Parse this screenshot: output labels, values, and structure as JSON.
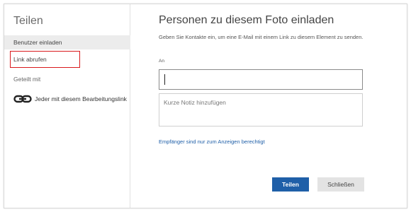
{
  "sidebar": {
    "title": "Teilen",
    "items": [
      {
        "label": "Benutzer einladen",
        "selected": true
      },
      {
        "label": "Link abrufen",
        "selected": false,
        "highlighted": true
      }
    ],
    "shared_with_label": "Geteilt mit",
    "shared_entries": [
      {
        "icon": "link-icon",
        "label": "Jeder mit diesem Bearbeitungslink"
      }
    ]
  },
  "main": {
    "title": "Personen zu diesem Foto einladen",
    "description": "Geben Sie Kontakte ein, um eine E-Mail mit einem Link zu diesem Element zu senden.",
    "to_label": "An",
    "to_value": "",
    "note_placeholder": "Kurze Notiz hinzufügen",
    "permissions_link": "Empfänger sind nur zum Anzeigen berechtigt",
    "share_button": "Teilen",
    "close_button": "Schließen"
  },
  "colors": {
    "accent": "#1f5fa8",
    "highlight_box": "#d9191c",
    "selected_bg": "#ececec"
  }
}
